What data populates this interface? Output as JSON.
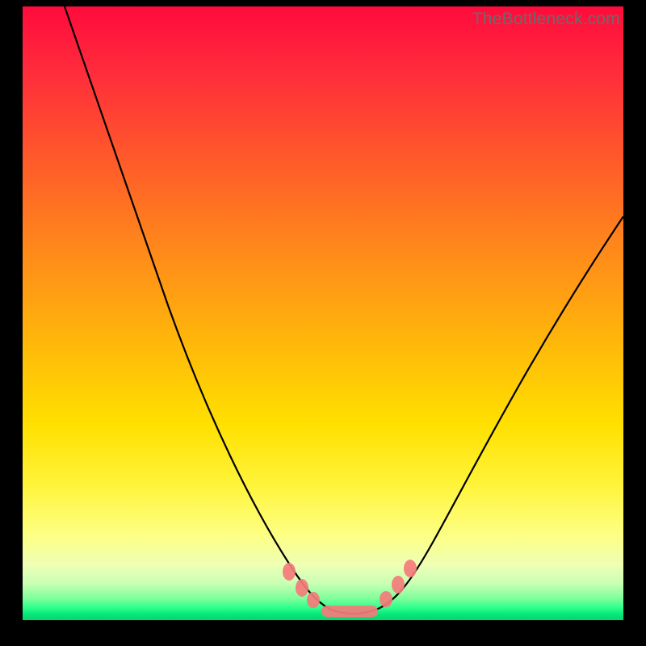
{
  "watermark": "TheBottleneck.com",
  "chart_data": {
    "type": "line",
    "title": "",
    "xlabel": "",
    "ylabel": "",
    "xlim": [
      0,
      100
    ],
    "ylim": [
      0,
      100
    ],
    "grid": false,
    "legend": false,
    "background_gradient": [
      "#ff0b3c",
      "#ffe000",
      "#08e87a"
    ],
    "series": [
      {
        "name": "bottleneck-curve",
        "x": [
          7,
          12,
          18,
          25,
          32,
          38,
          43,
          47,
          50,
          54,
          58,
          62,
          70,
          80,
          90,
          100
        ],
        "y": [
          100,
          85,
          67,
          47,
          30,
          17,
          8,
          3,
          1,
          1,
          3,
          8,
          22,
          40,
          55,
          67
        ]
      }
    ],
    "markers": {
      "name": "highlight-region",
      "color": "#f47b7b",
      "points_x": [
        44,
        46.5,
        49,
        52,
        55,
        57.5,
        60,
        62.5
      ],
      "points_y": [
        6.5,
        3.5,
        1.2,
        0.8,
        0.9,
        1.5,
        4,
        8
      ]
    }
  }
}
